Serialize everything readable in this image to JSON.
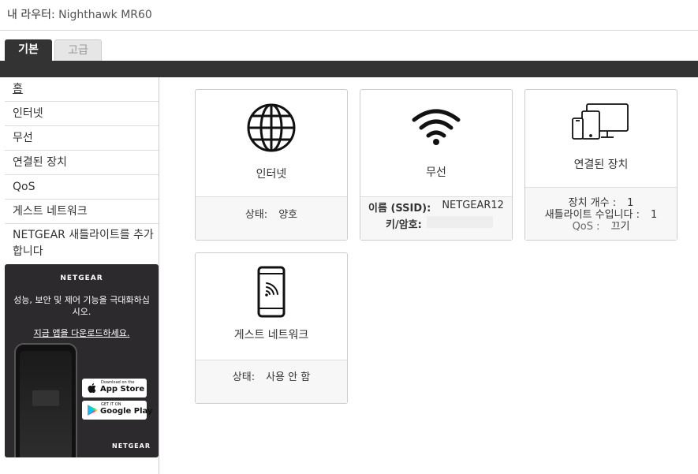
{
  "header": {
    "router_label": "내 라우터:",
    "router_name": "Nighthawk MR60"
  },
  "tabs": [
    {
      "label": "기본",
      "active": true
    },
    {
      "label": "고급",
      "active": false
    }
  ],
  "sidebar": {
    "items": [
      {
        "label": "홈"
      },
      {
        "label": "인터넷"
      },
      {
        "label": "무선"
      },
      {
        "label": "연결된 장치"
      },
      {
        "label": "QoS"
      },
      {
        "label": "게스트 네트워크"
      },
      {
        "label": "NETGEAR 새틀라이트를 추가합니다"
      }
    ]
  },
  "promo": {
    "brand": "NETGEAR",
    "text": "성능, 보안 및 제어 기능을 극대화하십시오.",
    "link": "지금 앱을 다운로드하세요.",
    "app_store_small": "Download on the",
    "app_store": "App Store",
    "google_play_small": "GET IT ON",
    "google_play": "Google Play"
  },
  "cards": {
    "internet": {
      "title": "인터넷",
      "status_label": "상태:",
      "status_value": "양호",
      "icon": "globe-icon"
    },
    "wireless": {
      "title": "무선",
      "ssid_label": "이름 (SSID):",
      "ssid_value": "NETGEAR12",
      "key_label": "키/암호:",
      "icon": "wifi-icon"
    },
    "devices": {
      "title": "연결된 장치",
      "count_label": "장치 개수 :",
      "count_value": "1",
      "satellite_label": "새틀라이트 수입니다 :",
      "satellite_value": "1",
      "qos_label": "QoS :",
      "qos_value": "끄기",
      "icon": "devices-icon"
    },
    "guest": {
      "title": "게스트 네트워크",
      "status_label": "상태:",
      "status_value": "사용 안 함",
      "icon": "phone-wifi-icon"
    }
  },
  "colors": {
    "dark_bar": "#333333",
    "promo_bg": "#2d2a2e"
  }
}
